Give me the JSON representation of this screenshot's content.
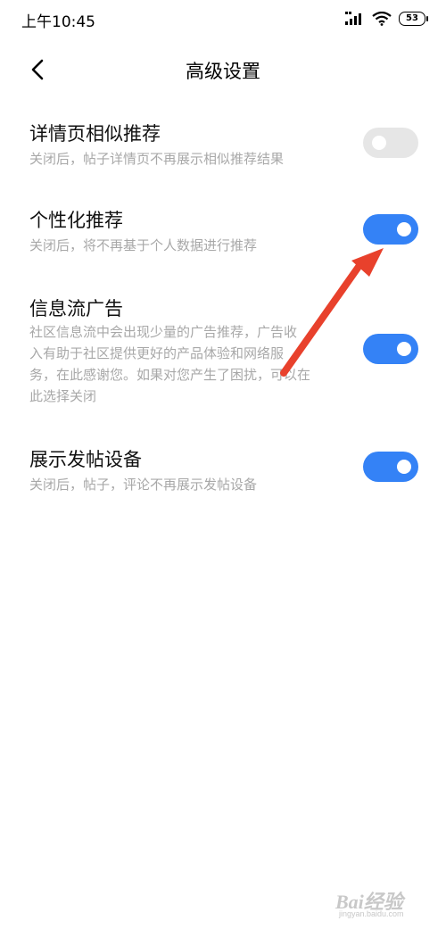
{
  "status_bar": {
    "time": "上午10:45",
    "battery": "53",
    "icons": [
      "signal-icon",
      "wifi-icon",
      "battery-icon"
    ]
  },
  "header": {
    "title": "高级设置",
    "back_icon": "chevron-left-icon"
  },
  "settings": [
    {
      "title": "详情页相似推荐",
      "desc": "关闭后，帖子详情页不再展示相似推荐结果",
      "enabled": false
    },
    {
      "title": "个性化推荐",
      "desc": "关闭后，将不再基于个人数据进行推荐",
      "enabled": true
    },
    {
      "title": "信息流广告",
      "desc_lines": [
        "社区信息流中会出现少量的广告推荐，广告收",
        "入有助于社区提供更好的产品体验和网络服",
        "务，在此感谢您。如果对您产生了困扰，可以在",
        "此选择关闭"
      ],
      "enabled": true
    },
    {
      "title": "展示发帖设备",
      "desc": "关闭后，帖子，评论不再展示发帖设备",
      "enabled": true
    }
  ],
  "colors": {
    "toggle_on": "#3482f6",
    "toggle_off": "#e6e6e6",
    "annotation_arrow": "#e8412c"
  },
  "watermark": {
    "logo": "Bai经验",
    "sub": "jingyan.baidu.com"
  }
}
